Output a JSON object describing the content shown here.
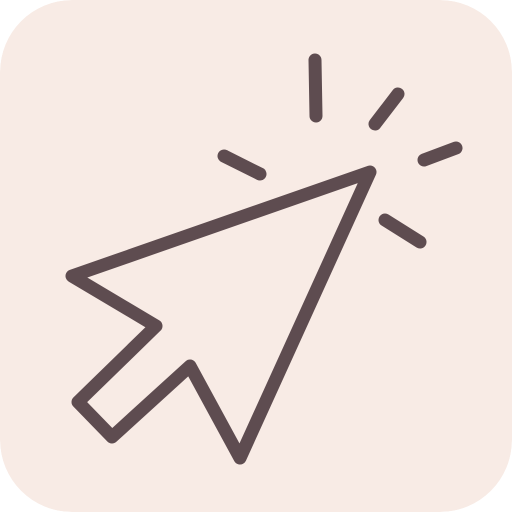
{
  "icon": {
    "name": "cursor-click-icon",
    "background_color": "#f8ebe5",
    "stroke_color": "#5e4c50"
  }
}
